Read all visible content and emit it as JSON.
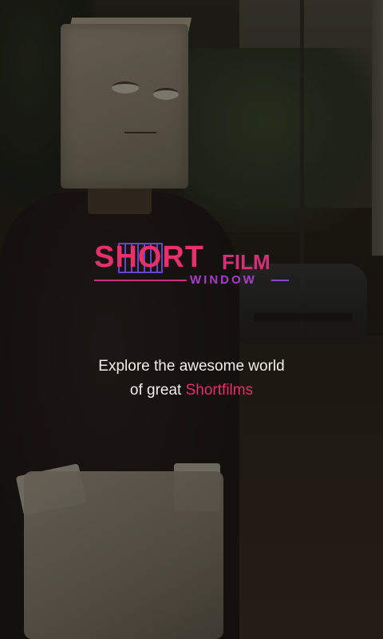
{
  "logo": {
    "short": "SHORT",
    "film": "FILM",
    "window": "WINDOW"
  },
  "tagline": {
    "line1": "Explore the awesome world",
    "line2_prefix": "of great ",
    "line2_accent": "Shortfilms"
  },
  "colors": {
    "accent": "#e8306a",
    "secondary": "#a63ec8",
    "text": "#f2efe9"
  }
}
